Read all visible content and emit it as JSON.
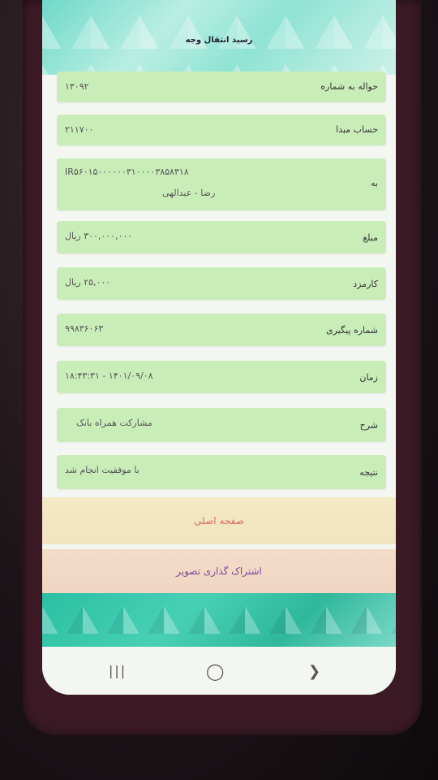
{
  "title": "رسید انتقال وجه",
  "rows": [
    {
      "label": "حواله به شماره",
      "value": "۱۳۰۹۲"
    },
    {
      "label": "حساب مبدا",
      "value": "۲۱۱۷۰۰"
    },
    {
      "label": "به",
      "value": "IR۵۶۰۱۵۰۰۰۰۰۰۳۱۰۰۰۰۳۸۵۸۳۱۸",
      "value2": "رضا - عبدالهی"
    },
    {
      "label": "مبلغ",
      "value": "۳۰۰,۰۰۰,۰۰۰ ریال"
    },
    {
      "label": "کارمزد",
      "value": "۲۵,۰۰۰ ریال"
    },
    {
      "label": "شماره پیگیری",
      "value": "۹۹۸۳۶۰۶۳"
    },
    {
      "label": "زمان",
      "value": "۱۴۰۱/۰۹/۰۸ - ۱۸:۴۳:۳۱"
    },
    {
      "label": "شرح",
      "value": "مشارکت همراه بانک"
    },
    {
      "label": "نتیجه",
      "value": "با موفقیت انجام شد"
    }
  ],
  "buttons": {
    "home": "صفحه اصلی",
    "share": "اشتراک گذاری تصویر"
  },
  "nav": {
    "recents": "|||",
    "home": "◯",
    "back": "❯"
  }
}
